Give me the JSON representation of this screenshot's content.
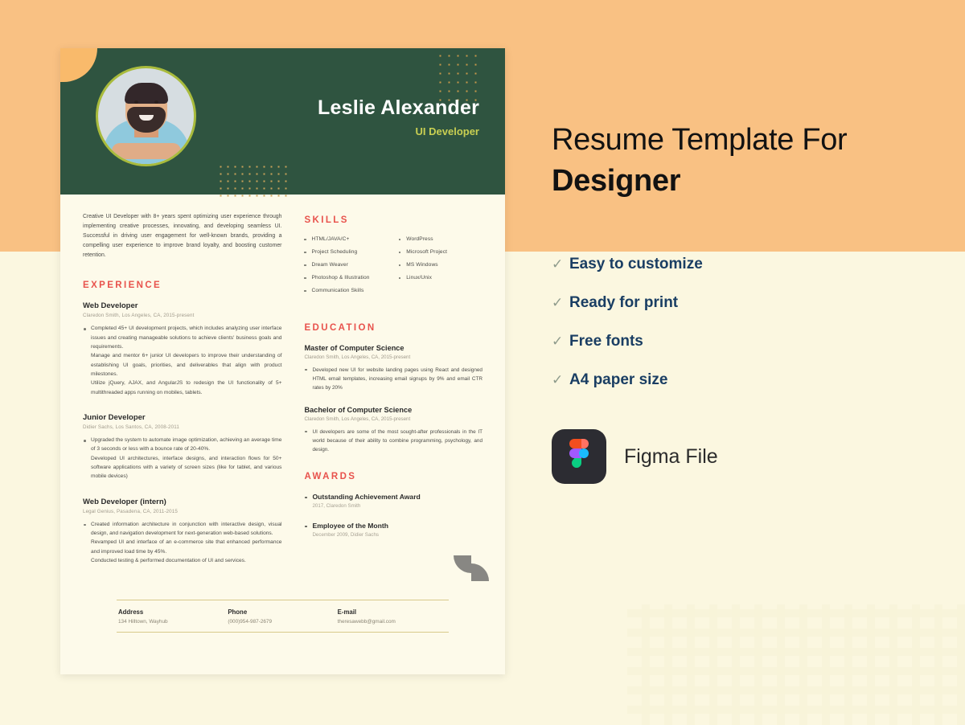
{
  "colors": {
    "backdrop_orange": "#f9c183",
    "backdrop_cream": "#fbf7e0",
    "resume_paper": "#fdfaea",
    "header_green": "#2f5440",
    "accent_red": "#e8524c",
    "accent_gold": "#c9a25a",
    "role_yellow": "#c9cf52",
    "feature_navy": "#1a3e63",
    "check_gray": "#8e9b8c",
    "figma_badge": "#2c2c32"
  },
  "resume": {
    "header": {
      "name": "Leslie Alexander",
      "role": "UI Developer",
      "photo_alt": "portrait-photo"
    },
    "summary": "Creative UI Developer with 8+ years spent optimizing user experience through implementing creative processes, innovating, and developing seamless UI. Successful in driving user engagement for well-known brands, providing a compelling user experience to improve brand loyalty, and boosting customer retention.",
    "experience": {
      "title": "EXPERIENCE",
      "jobs": [
        {
          "title": "Web Developer",
          "meta": "Claredon Smith, Los Angeles, CA, 2015-present",
          "bullet": "Completed 45+ UI development projects, which includes analyzing user interface issues and creating manageable solutions to achieve clients' business goals and requirements.",
          "lines": [
            "Manage and mentor 6+ junior UI developers to improve their understanding of establishing UI goals, priorities, and deliverables that align with product milestones.",
            "Utilize jQuery, AJAX, and AngularJS to redesign the UI functionality of 5+ multithreaded apps running on mobiles, tablets."
          ]
        },
        {
          "title": "Junior Developer",
          "meta": "Didier Sachs, Los Santos, CA, 2008-2011",
          "bullet": "Upgraded the system to automate image optimization, achieving an average time of 3 seconds or less with a bounce rate of 20-40%.",
          "lines": [
            "Developed UI architectures, interface designs, and interaction flows for 50+ software applications with a variety of screen sizes (like for tablet, and various mobile devices)"
          ]
        },
        {
          "title": "Web Developer (intern)",
          "meta": "Legal Genius, Pasadena, CA, 2011-2015",
          "bullet": "Created information architecture in conjunction with interactive design, visual design, and navigation development for next-generation web-based solutions.",
          "lines": [
            "Revamped UI and interface of an e-commerce site that enhanced performance and improved load time by 45%.",
            "Conducted testing & performed documentation of UI and services."
          ]
        }
      ]
    },
    "skills": {
      "title": "SKILLS",
      "column_left": [
        "HTML/JAVA/C+",
        "Project Scheduling",
        "Dream Weaver",
        "Photoshop & Illustration",
        "Communication Skills"
      ],
      "column_right": [
        "WordPress",
        "Microsoft Project",
        "MS Windows",
        "Linux/Unix"
      ]
    },
    "education": {
      "title": "EDUCATION",
      "entries": [
        {
          "title": "Master of Computer Science",
          "meta": "Claredon Smith, Los Angeles, CA, 2015-present",
          "bullet": "Developed new UI for website landing pages using React and designed HTML email templates, increasing email signups by 9% and email CTR rates by 20%"
        },
        {
          "title": "Bachelor of Computer Science",
          "meta": "Claredon Smith, Los Angeles, CA, 2015-present",
          "bullet": "UI developers are some of the most sought-after professionals in the IT world because of their ability to combine programming, psychology, and design."
        }
      ]
    },
    "awards": {
      "title": "AWARDS",
      "entries": [
        {
          "name": "Outstanding Achievement Award",
          "meta": "2017, Claredon Smith"
        },
        {
          "name": "Employee of the Month",
          "meta": "December 2009, Didier Sachs"
        }
      ]
    },
    "contact": {
      "address_label": "Address",
      "address_value": "134 Hilltown, Wayhub",
      "phone_label": "Phone",
      "phone_value": "(000)954-987-2679",
      "email_label": "E-mail",
      "email_value": "theresawebb@gmail.com"
    }
  },
  "promo": {
    "title_line1": "Resume Template For",
    "title_line2": "Designer",
    "features": [
      {
        "check": "✓",
        "label": "Easy to customize"
      },
      {
        "check": "✓",
        "label": "Ready for print"
      },
      {
        "check": "✓",
        "label": "Free fonts"
      },
      {
        "check": "✓",
        "label": "A4 paper size"
      }
    ],
    "figma_label": "Figma File"
  }
}
